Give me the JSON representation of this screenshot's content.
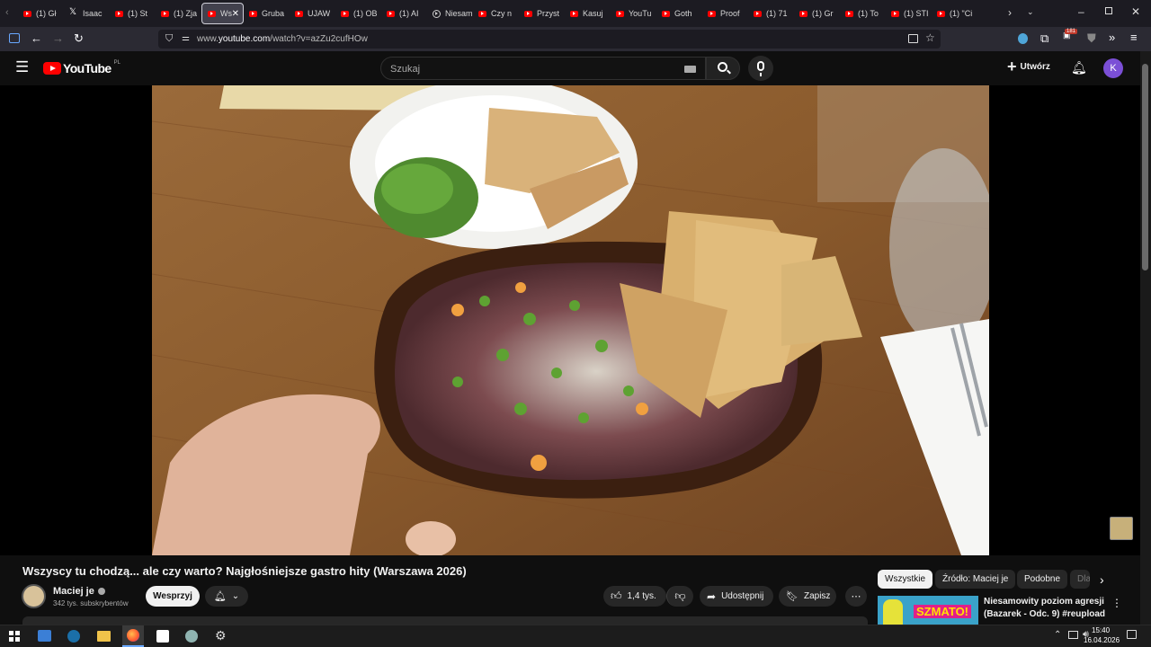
{
  "browser": {
    "tabs": [
      {
        "label": "(1) Gł",
        "icon": "youtube-icon"
      },
      {
        "label": "Isaac",
        "icon": "x-icon"
      },
      {
        "label": "(1) St",
        "icon": "youtube-icon"
      },
      {
        "label": "(1) Zja",
        "icon": "youtube-icon"
      },
      {
        "label": "Ws",
        "icon": "youtube-icon",
        "active": true
      },
      {
        "label": "Gruba",
        "icon": "youtube-icon"
      },
      {
        "label": "UJAW",
        "icon": "youtube-icon"
      },
      {
        "label": "(1) OB",
        "icon": "youtube-icon"
      },
      {
        "label": "(1) AI",
        "icon": "youtube-icon"
      },
      {
        "label": "Niesam",
        "icon": "globe-icon"
      },
      {
        "label": "Czy n",
        "icon": "youtube-icon"
      },
      {
        "label": "Przyst",
        "icon": "youtube-icon"
      },
      {
        "label": "Kasuj",
        "icon": "youtube-icon"
      },
      {
        "label": "YouTu",
        "icon": "youtube-icon"
      },
      {
        "label": "Goth",
        "icon": "youtube-icon"
      },
      {
        "label": "Proof",
        "icon": "youtube-icon"
      },
      {
        "label": "(1) 71",
        "icon": "youtube-icon"
      },
      {
        "label": "(1) Gr",
        "icon": "youtube-icon"
      },
      {
        "label": "(1) To",
        "icon": "youtube-icon"
      },
      {
        "label": "(1) STI",
        "icon": "youtube-icon"
      },
      {
        "label": "(1) \"Ci",
        "icon": "youtube-icon"
      }
    ],
    "url_prefix": "www.",
    "url_domain": "youtube.com",
    "url_path": "/watch?v=azZu2cufHOw",
    "extension_badge": "181"
  },
  "youtube": {
    "logo_text": "YouTube",
    "region": "PL",
    "search_placeholder": "Szukaj",
    "create_label": "Utwórz",
    "avatar_letter": "K",
    "accent_red": "#ff0000",
    "avatar_color": "#7b4fd6"
  },
  "video": {
    "title": "Wszyscy tu chodzą... ale czy warto? Najgłośniejsze gastro hity (Warszawa 2026)",
    "channel_name": "Maciej je",
    "subscribers": "342 tys. subskrybentów",
    "support_label": "Wesprzyj",
    "likes": "1,4 tys.",
    "share_label": "Udostępnij",
    "save_label": "Zapisz"
  },
  "chips": [
    "Wszystkie",
    "Źródło: Maciej je",
    "Podobne",
    "Dla"
  ],
  "recommendation": {
    "title_line1": "Niesamowity poziom agresji",
    "title_line2": "(Bazarek - Odc. 9) #reupload",
    "thumb_text": "SZMATO!"
  },
  "taskbar": {
    "time": "15:40",
    "date": "16.04.2026"
  }
}
